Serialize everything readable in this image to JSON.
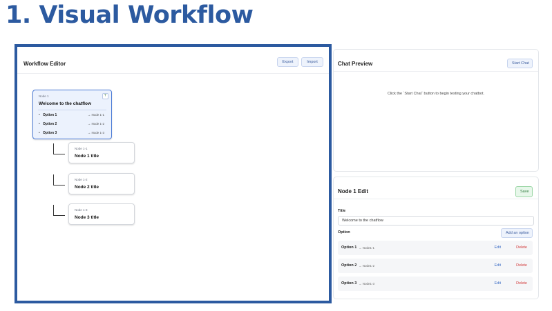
{
  "heading": "1. Visual Workflow",
  "editor": {
    "title": "Workflow Editor",
    "export_label": "Export",
    "import_label": "Import",
    "root": {
      "id": "Node 1",
      "title": "Welcome to the chatflow",
      "add_icon": "+",
      "options": [
        {
          "bullet": "•",
          "label": "Option 1",
          "target": "→ Node 1-1"
        },
        {
          "bullet": "•",
          "label": "Option 2",
          "target": "→ Node 1-2"
        },
        {
          "bullet": "•",
          "label": "Option 3",
          "target": "→ Node 1-3"
        }
      ]
    },
    "children": [
      {
        "id": "Node 1-1",
        "title": "Node 1 title"
      },
      {
        "id": "Node 1-2",
        "title": "Node 2 title"
      },
      {
        "id": "Node 1-3",
        "title": "Node 3 title"
      }
    ]
  },
  "chat": {
    "title": "Chat Preview",
    "start_label": "Start Chat",
    "message": "Click the `Start Chat` button to begin testing your chatbot."
  },
  "edit": {
    "title": "Node 1 Edit",
    "save_label": "Save",
    "title_label": "Title",
    "title_value": "Welcome to the chatflow",
    "option_label": "Option",
    "add_option_label": "Add an option",
    "options": [
      {
        "label": "Option 1",
        "target": "→ Node1-1",
        "edit": "Edit",
        "delete": "Delete"
      },
      {
        "label": "Option 2",
        "target": "→ Node1-2",
        "edit": "Edit",
        "delete": "Delete"
      },
      {
        "label": "Option 3",
        "target": "→ Node1-3",
        "edit": "Edit",
        "delete": "Delete"
      }
    ]
  }
}
